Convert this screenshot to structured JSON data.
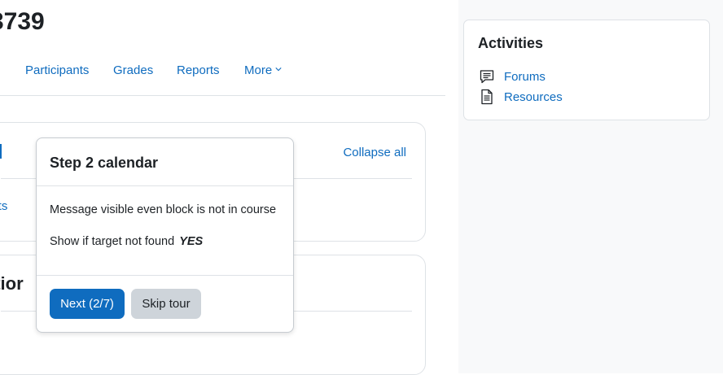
{
  "course": {
    "title_fragment": "3739"
  },
  "nav": {
    "participants": "Participants",
    "grades": "Grades",
    "reports": "Reports",
    "more": "More"
  },
  "course_index": {
    "collapse_all": "Collapse all",
    "partial_link": "ents",
    "partial_section_heading": "ctior"
  },
  "tour": {
    "title": "Step 2 calendar",
    "message": "Message visible even block is not in course",
    "show_if_label": "Show if target not found",
    "show_if_value": "YES",
    "next_label": "Next (2/7)",
    "skip_label": "Skip tour"
  },
  "activities": {
    "title": "Activities",
    "items": [
      {
        "label": "Forums",
        "icon": "forum-icon"
      },
      {
        "label": "Resources",
        "icon": "resource-icon"
      }
    ]
  },
  "colors": {
    "link": "#0f6cbf",
    "primary_button": "#0f6cbf",
    "secondary_button": "#ced4da",
    "drawer_background": "#f8f9fa"
  }
}
